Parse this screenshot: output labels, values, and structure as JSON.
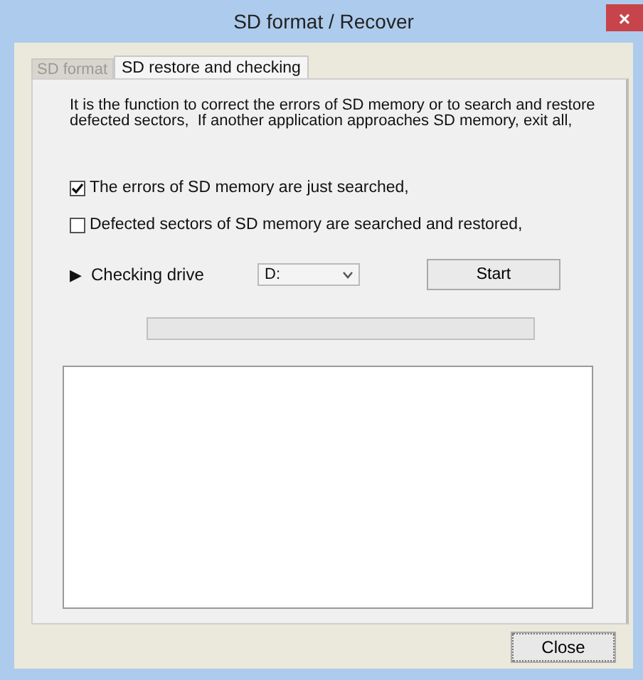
{
  "window": {
    "title": "SD format / Recover",
    "close": "×"
  },
  "tabs": [
    {
      "label": "SD format",
      "selected": false
    },
    {
      "label": "SD restore and checking",
      "selected": true
    }
  ],
  "description": "It is the function to correct the errors of SD memory or to search and restore defected sectors,  If another application approaches SD memory, exit all,",
  "options": [
    {
      "label": "The errors of SD memory are just searched,",
      "checked": true
    },
    {
      "label": "Defected sectors of SD memory are searched and restored,",
      "checked": false
    }
  ],
  "drive": {
    "marker": "▶",
    "label": "Checking drive",
    "value": "D:",
    "start": "Start"
  },
  "progress": {
    "level": 0
  },
  "buttons": [
    "Close"
  ]
}
